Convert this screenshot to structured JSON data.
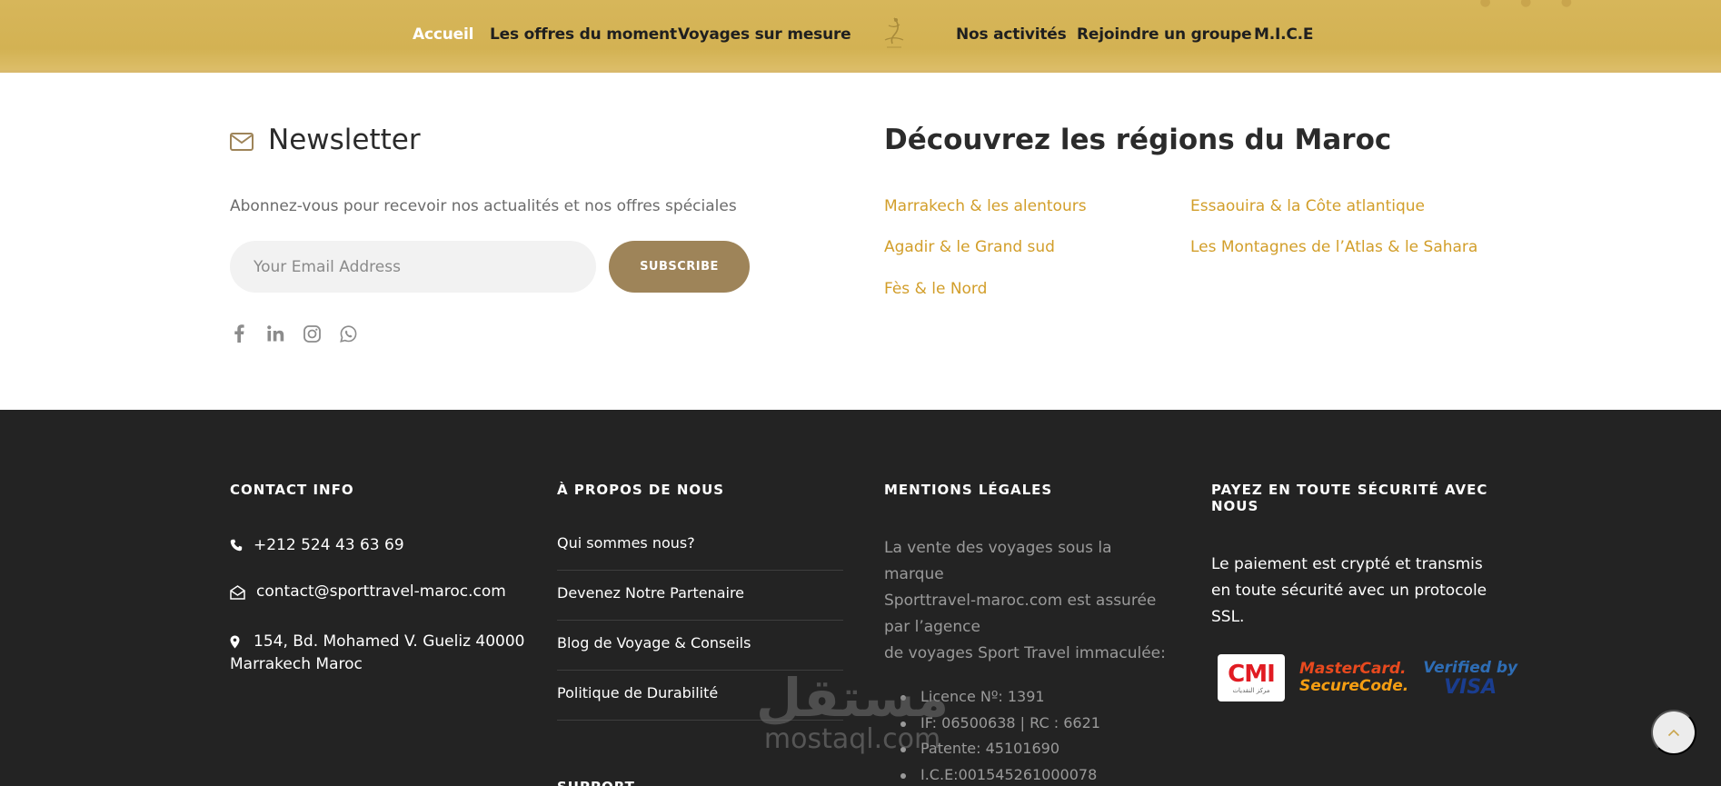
{
  "nav": {
    "items": [
      "Accueil",
      "Les offres du moment",
      "Voyages sur mesure",
      "Nos activités",
      "Rejoindre un groupe",
      "M.I.C.E"
    ],
    "active": "Accueil",
    "accent": "#d5b457"
  },
  "newsletter": {
    "title": "Newsletter",
    "subtitle": "Abonnez-vous pour recevoir nos actualités et nos offres spéciales",
    "email_placeholder": "Your Email Address",
    "subscribe_label": "SUBSCRIBE",
    "button_color": "#9e8459",
    "socials": [
      "facebook-icon",
      "linkedin-icon",
      "instagram-icon",
      "whatsapp-icon"
    ]
  },
  "regions": {
    "title": "Découvrez les régions du Maroc",
    "links": [
      "Marrakech & les alentours",
      "Essaouira & la Côte atlantique",
      "Agadir & le Grand sud",
      "Les Montagnes de l’Atlas & le Sahara",
      "Fès & le Nord"
    ],
    "link_color": "#d29e2a"
  },
  "footer": {
    "contact": {
      "title": "CONTACT INFO",
      "phone": "+212 524 43 63 69",
      "email": "contact@sporttravel-maroc.com",
      "address_line1": "154, Bd. Mohamed V. Gueliz 40000",
      "address_line2": "Marrakech Maroc"
    },
    "about": {
      "title": "À PROPOS DE NOUS",
      "links": [
        "Qui sommes nous?",
        "Devenez Notre Partenaire",
        "Blog de Voyage & Conseils",
        "Politique de Durabilité"
      ],
      "support_title": "SUPPORT"
    },
    "legal": {
      "title": "MENTIONS LÉGALES",
      "text_lines": [
        "La vente des voyages sous la",
        "marque",
        "Sporttravel-maroc.com est assurée",
        "par l’agence",
        "de voyages Sport Travel immaculée:"
      ],
      "items": [
        "Licence Nº: 1391",
        "IF: 06500638  | RC : 6621",
        "Patente: 45101690",
        "I.C.E:001545261000078"
      ]
    },
    "payment": {
      "title_line1": "PAYEZ EN TOUTE SÉCURITÉ AVEC",
      "title_line2": "NOUS",
      "text": "Le paiement est crypté et transmis en toute sécurité avec un protocole SSL.",
      "cmi_label": "CMI",
      "cmi_sub": "مركز النقديات",
      "mastercard_l1": "MasterCard.",
      "mastercard_l2": "SecureCode.",
      "visa_l1": "Verified by",
      "visa_l2": "VISA"
    }
  },
  "watermark": {
    "arabic": "مستقل",
    "latin": "mostaql.com"
  }
}
